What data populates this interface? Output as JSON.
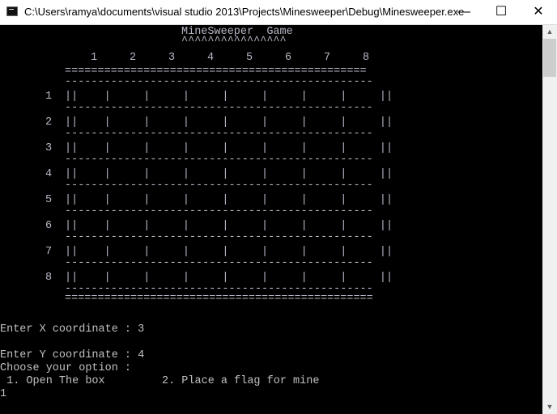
{
  "window": {
    "title": "C:\\Users\\ramya\\documents\\visual studio 2013\\Projects\\Minesweeper\\Debug\\Minesweeper.exe",
    "controls": {
      "minimize": "—",
      "maximize": "☐",
      "close": "✕"
    }
  },
  "console": {
    "game_title": "MineSweeper  Game",
    "title_underline": "^^^^^^^^^^^^^^^^",
    "col_numbers": [
      "1",
      "2",
      "3",
      "4",
      "5",
      "6",
      "7",
      "8"
    ],
    "row_numbers": [
      "1",
      "2",
      "3",
      "4",
      "5",
      "6",
      "7",
      "8"
    ],
    "border_line": "==============================================",
    "border_line_bottom": "===============================================",
    "dash_line": "-----------------------------------------------",
    "cell_row": "||    |     |     |     |     |     |     |     ||",
    "prompt_x": "Enter X coordinate : 3",
    "prompt_y": "Enter Y coordinate : 4",
    "choose_option": "Choose your option :",
    "option_1": " 1. Open The box",
    "option_2": "2. Place a flag for mine",
    "user_input": "1"
  },
  "scrollbar": {
    "up": "▲",
    "down": "▼"
  }
}
